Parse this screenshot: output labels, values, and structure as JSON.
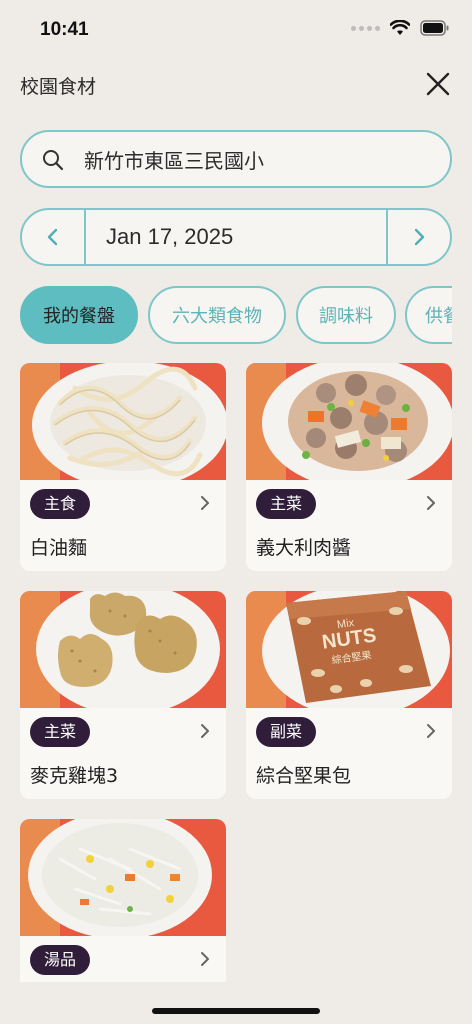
{
  "status": {
    "time": "10:41"
  },
  "header": {
    "title": "校園食材"
  },
  "search": {
    "value": "新竹市東區三民國小"
  },
  "date": {
    "label": "Jan 17, 2025"
  },
  "tabs": [
    {
      "label": "我的餐盤",
      "active": true
    },
    {
      "label": "六大類食物",
      "active": false
    },
    {
      "label": "調味料",
      "active": false
    },
    {
      "label": "供餐",
      "active": false
    }
  ],
  "foods": [
    {
      "category": "主食",
      "name": "白油麵",
      "image": "noodles"
    },
    {
      "category": "主菜",
      "name": "義大利肉醬",
      "image": "meat-sauce"
    },
    {
      "category": "主菜",
      "name": "麥克雞塊3",
      "image": "chicken-nuggets"
    },
    {
      "category": "副菜",
      "name": "綜合堅果包",
      "image": "nuts-pack"
    },
    {
      "category": "湯品",
      "name": "",
      "image": "soup"
    }
  ],
  "nuts_pack_text": {
    "line1": "Mix",
    "line2": "NUTS",
    "line3": "綜合堅果"
  },
  "colors": {
    "accent": "#5ebdc0",
    "border": "#7fc6c8",
    "badge": "#2f1d3a",
    "background": "#efebe7"
  }
}
